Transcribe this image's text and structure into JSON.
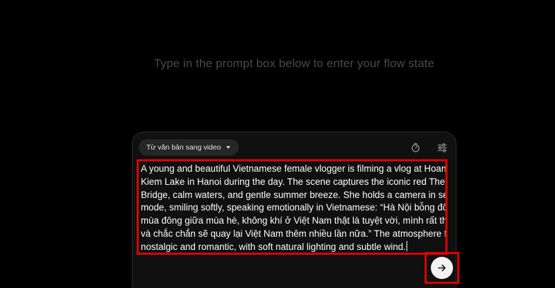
{
  "header": {
    "tagline": "Type in the prompt box below to enter your flow state"
  },
  "composer": {
    "mode_label": "Từ văn bản sang video",
    "mode_icon": "chevron-down-icon",
    "tools": [
      {
        "icon": "timer-icon"
      },
      {
        "icon": "sliders-icon"
      }
    ],
    "prompt_lines": [
      "A young and beautiful Vietnamese female vlogger is filming a vlog at Hoan",
      "Kiem Lake in Hanoi during the day. The scene captures the iconic red The Huc",
      "Bridge, calm waters, and gentle summer breeze. She holds a camera in selfie",
      "mode, smiling softly, speaking emotionally in Vietnamese: “Hà Nội bỗng đổ",
      "mùa đông giữa mùa hè, không khí ở Việt Nam thật là tuyệt vời, mình rất thích",
      "và chắc chắn sẽ quay lại Việt Nam thêm nhiều lần nữa.” The atmosphere feels",
      "nostalgic and romantic, with soft natural lighting and subtle wind."
    ],
    "send_icon": "arrow-right-icon"
  },
  "colors": {
    "background": "#000000",
    "panel": "#101010",
    "highlight": "#e00000",
    "send_button": "#f2f2f2"
  }
}
